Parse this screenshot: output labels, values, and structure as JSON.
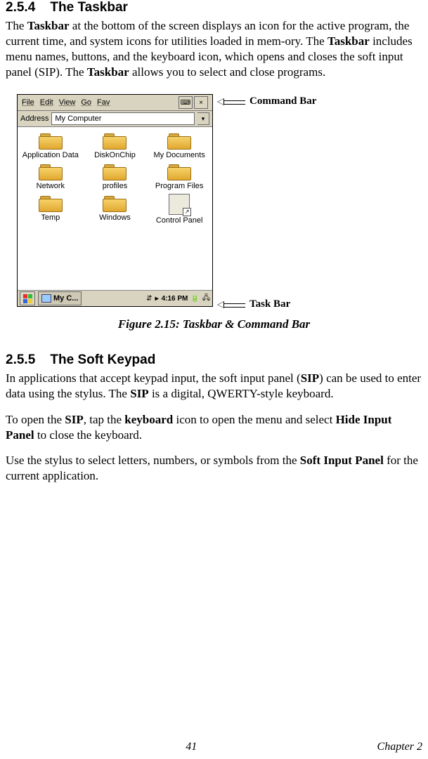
{
  "section254": {
    "num": "2.5.4",
    "title": "The Taskbar"
  },
  "para254": {
    "t1": "The ",
    "b1": "Taskbar",
    "t2": " at the bottom of the screen displays an icon for the active program, the current time, and system icons for utilities loaded in mem-ory. The ",
    "b2": "Taskbar",
    "t3": " includes menu names, buttons, and the keyboard icon, which opens and closes the soft input panel (SIP). The ",
    "b3": "Taskbar",
    "t4": " allows you to select and close programs."
  },
  "shot": {
    "menu": {
      "file": "File",
      "edit": "Edit",
      "view": "View",
      "go": "Go",
      "fav": "Fav",
      "kbd": "⌨",
      "close": "×"
    },
    "addr": {
      "label": "Address",
      "value": "My Computer",
      "drop": "▾"
    },
    "icons": [
      {
        "name": "Application Data",
        "type": "folder"
      },
      {
        "name": "DiskOnChip",
        "type": "folder"
      },
      {
        "name": "My Documents",
        "type": "folder"
      },
      {
        "name": "Network",
        "type": "folder"
      },
      {
        "name": "profiles",
        "type": "folder"
      },
      {
        "name": "Program Files",
        "type": "folder"
      },
      {
        "name": "Temp",
        "type": "folder"
      },
      {
        "name": "Windows",
        "type": "folder"
      },
      {
        "name": "Control Panel",
        "type": "ctrl"
      }
    ],
    "task": {
      "btn": "My C...",
      "time": "4:16 PM",
      "arrow": "▸",
      "sep": "🗓",
      "net": "🖧"
    }
  },
  "annot": {
    "cmd": "Command Bar",
    "task": "Task Bar"
  },
  "caption": "Figure 2.15: Taskbar & Command Bar",
  "section255": {
    "num": "2.5.5",
    "title": "The Soft Keypad"
  },
  "para255a": {
    "t1": "In applications that accept keypad input, the soft input panel (",
    "b1": "SIP",
    "t2": ") can be used to enter data using the stylus. The ",
    "b2": "SIP",
    "t3": " is a digital, QWERTY-style keyboard."
  },
  "para255b": {
    "t1": "To open the ",
    "b1": "SIP",
    "t2": ", tap the ",
    "b2": "keyboard",
    "t3": " icon to open the menu and select ",
    "b3": "Hide Input Panel",
    "t4": " to close the keyboard."
  },
  "para255c": {
    "t1": "Use the stylus to select letters, numbers, or symbols from the ",
    "b1": "Soft Input Panel",
    "t2": " for the current application."
  },
  "footer": {
    "page": "41",
    "chap": "Chapter 2"
  }
}
